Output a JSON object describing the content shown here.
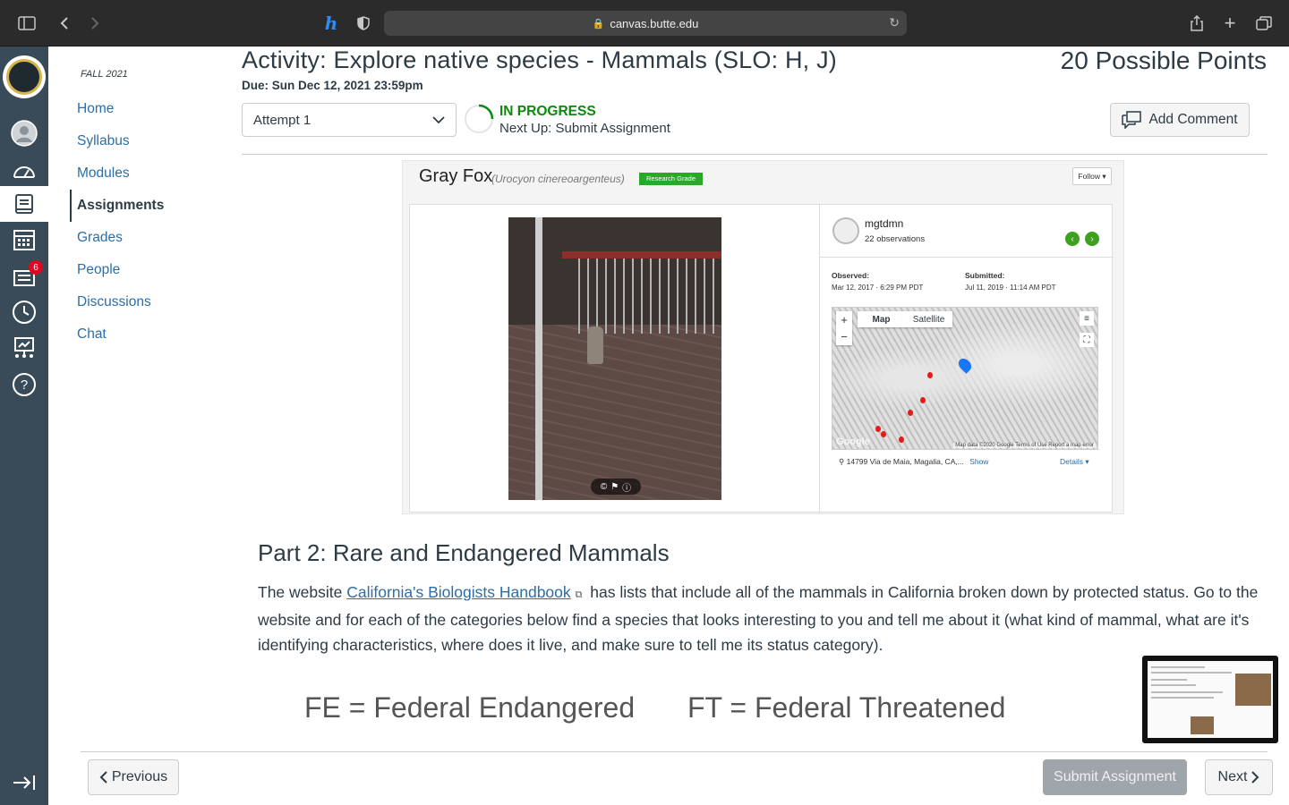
{
  "browser": {
    "url": "canvas.butte.edu"
  },
  "global_nav": {
    "items": [
      "account-icon",
      "dashboard-icon",
      "courses-icon",
      "calendar-icon",
      "inbox-icon",
      "history-icon",
      "commons-icon",
      "help-icon"
    ],
    "inbox_badge": "6"
  },
  "course_nav": {
    "term": "FALL 2021",
    "items": [
      {
        "label": "Home"
      },
      {
        "label": "Syllabus"
      },
      {
        "label": "Modules"
      },
      {
        "label": "Assignments",
        "active": true
      },
      {
        "label": "Grades"
      },
      {
        "label": "People"
      },
      {
        "label": "Discussions"
      },
      {
        "label": "Chat"
      }
    ]
  },
  "header": {
    "title": "Activity: Explore native species - Mammals (SLO: H, J)",
    "points": "20 Possible Points",
    "due": "Due: Sun Dec 12, 2021 23:59pm",
    "attempt": "Attempt 1",
    "status": "IN PROGRESS",
    "next_up": "Next Up: Submit Assignment",
    "add_comment": "Add Comment"
  },
  "observation": {
    "common_name": "Gray Fox",
    "scientific_name": "(Urocyon cinereoargenteus)",
    "grade_badge": "Research Grade",
    "follow": "Follow ▾",
    "username": "mgtdmn",
    "observations": "22 observations",
    "observed_label": "Observed:",
    "observed_value": "Mar 12, 2017 · 6:29 PM PDT",
    "submitted_label": "Submitted:",
    "submitted_value": "Jul 11, 2019 · 11:14 AM PDT",
    "map_tab": "Map",
    "satellite_tab": "Satellite",
    "map_attribution": "Map data ©2020 Google   Terms of Use   Report a map error",
    "google_logo": "Google",
    "address": "14799 Via de Maia, Magalia, CA,...",
    "show": "Show",
    "details": "Details ▾"
  },
  "content": {
    "heading": "Part 2: Rare and Endangered Mammals",
    "para_before": "The website ",
    "link_text": "California's Biologists Handbook",
    "para_after": " has lists that include all of the mammals in California broken down by protected status. Go to the website and for each of the categories below find a species that looks interesting to you and tell me about it (what kind of mammal, what are it's identifying characteristics, where does it live, and make sure to tell me its status category).",
    "cat_fe": "FE = Federal Endangered",
    "cat_ft": "FT = Federal Threatened"
  },
  "footer": {
    "previous": "Previous",
    "submit": "Submit Assignment",
    "next": "Next"
  }
}
